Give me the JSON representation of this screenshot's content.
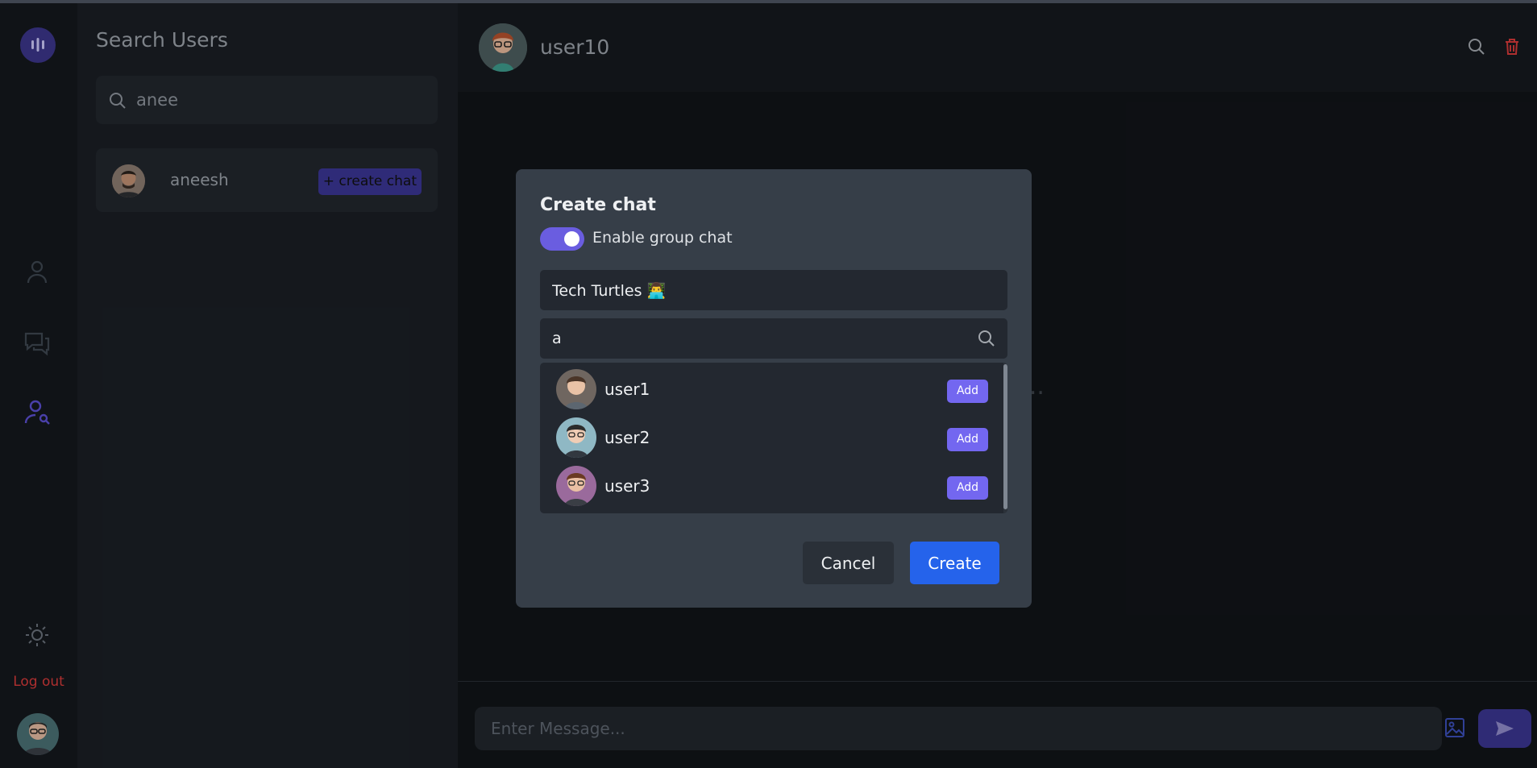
{
  "sidebar": {
    "logout_label": "Log out"
  },
  "search_panel": {
    "title": "Search Users",
    "query": "anee",
    "results": [
      {
        "name": "aneesh",
        "action_label": "+ create chat"
      }
    ]
  },
  "chat": {
    "title": "user10",
    "empty_text": "es Yet...",
    "message_placeholder": "Enter Message..."
  },
  "modal": {
    "title": "Create chat",
    "toggle_label": "Enable group chat",
    "group_name": "Tech Turtles 👨‍💻",
    "user_search": "a",
    "users": [
      {
        "name": "user1",
        "add_label": "Add"
      },
      {
        "name": "user2",
        "add_label": "Add"
      },
      {
        "name": "user3",
        "add_label": "Add"
      }
    ],
    "cancel_label": "Cancel",
    "create_label": "Create"
  },
  "colors": {
    "accent": "#6a5de0",
    "primary_button": "#2563eb",
    "danger": "#d53a3a"
  }
}
